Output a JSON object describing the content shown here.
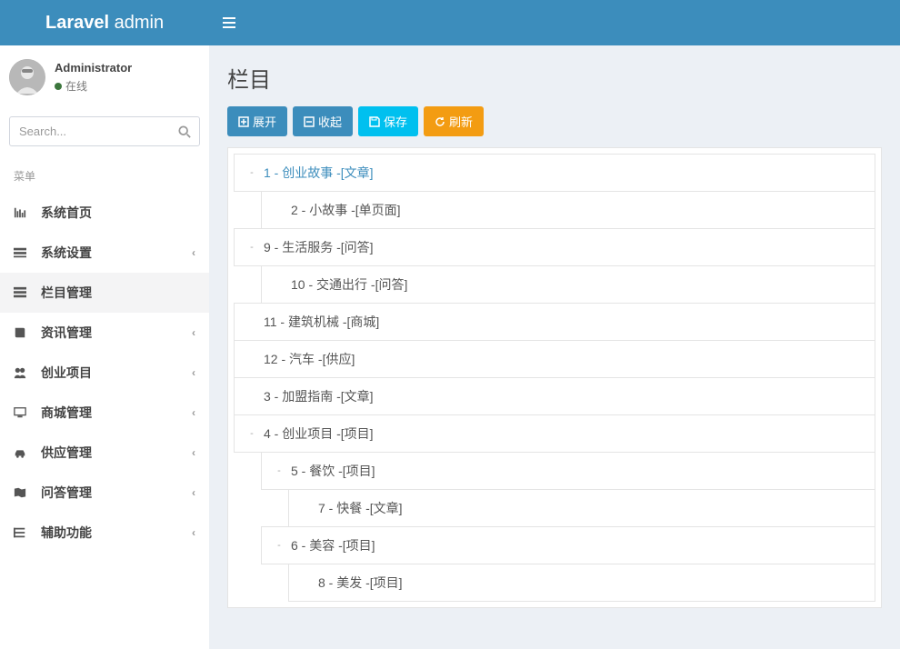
{
  "header": {
    "logo_bold": "Laravel",
    "logo_light": " admin"
  },
  "user": {
    "name": "Administrator",
    "status": "在线"
  },
  "search": {
    "placeholder": "Search..."
  },
  "menu_header": "菜单",
  "menu": [
    {
      "icon": "bars-icon",
      "label": "系统首页",
      "chevron": false,
      "active": false
    },
    {
      "icon": "cogs-icon",
      "label": "系统设置",
      "chevron": true,
      "active": false
    },
    {
      "icon": "list-icon",
      "label": "栏目管理",
      "chevron": false,
      "active": true
    },
    {
      "icon": "book-icon",
      "label": "资讯管理",
      "chevron": true,
      "active": false
    },
    {
      "icon": "users-icon",
      "label": "创业项目",
      "chevron": true,
      "active": false
    },
    {
      "icon": "desktop-icon",
      "label": "商城管理",
      "chevron": true,
      "active": false
    },
    {
      "icon": "car-icon",
      "label": "供应管理",
      "chevron": true,
      "active": false
    },
    {
      "icon": "map-icon",
      "label": "问答管理",
      "chevron": true,
      "active": false
    },
    {
      "icon": "th-icon",
      "label": "辅助功能",
      "chevron": true,
      "active": false
    }
  ],
  "page_title": "栏目",
  "toolbar": {
    "expand": "展开",
    "collapse": "收起",
    "save": "保存",
    "refresh": "刷新"
  },
  "tree": [
    {
      "level": 0,
      "toggle": "-",
      "label": "1 - 创业故事 -[文章]",
      "link": true
    },
    {
      "level": 1,
      "toggle": "",
      "label": "2 - 小故事 -[单页面]"
    },
    {
      "level": 0,
      "toggle": "-",
      "label": "9 - 生活服务 -[问答]"
    },
    {
      "level": 1,
      "toggle": "",
      "label": "10 - 交通出行 -[问答]"
    },
    {
      "level": 0,
      "toggle": "",
      "label": "11 - 建筑机械 -[商城]"
    },
    {
      "level": 0,
      "toggle": "",
      "label": "12 - 汽车 -[供应]"
    },
    {
      "level": 0,
      "toggle": "",
      "label": "3 - 加盟指南 -[文章]"
    },
    {
      "level": 0,
      "toggle": "-",
      "label": "4 - 创业项目 -[项目]"
    },
    {
      "level": 1,
      "toggle": "-",
      "label": "5 - 餐饮 -[项目]"
    },
    {
      "level": 2,
      "toggle": "",
      "label": "7 - 快餐 -[文章]"
    },
    {
      "level": 1,
      "toggle": "-",
      "label": "6 - 美容 -[项目]"
    },
    {
      "level": 2,
      "toggle": "",
      "label": "8 - 美发 -[项目]"
    }
  ]
}
